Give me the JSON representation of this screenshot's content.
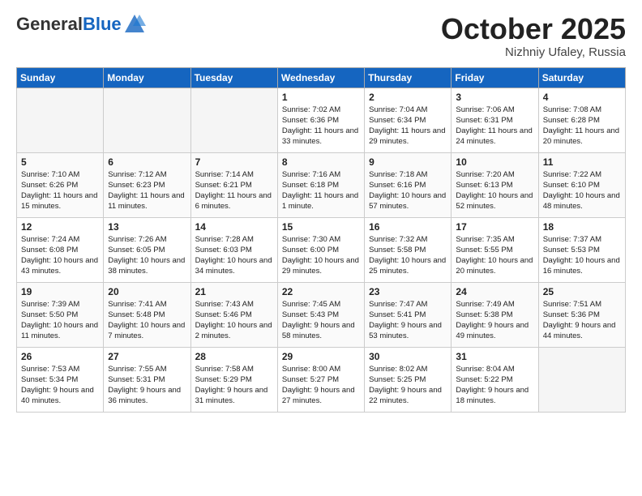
{
  "header": {
    "logo_general": "General",
    "logo_blue": "Blue",
    "month_title": "October 2025",
    "location": "Nizhniy Ufaley, Russia"
  },
  "weekdays": [
    "Sunday",
    "Monday",
    "Tuesday",
    "Wednesday",
    "Thursday",
    "Friday",
    "Saturday"
  ],
  "weeks": [
    [
      {
        "day": "",
        "empty": true
      },
      {
        "day": "",
        "empty": true
      },
      {
        "day": "",
        "empty": true
      },
      {
        "day": "1",
        "sunrise": "7:02 AM",
        "sunset": "6:36 PM",
        "daylight": "11 hours and 33 minutes."
      },
      {
        "day": "2",
        "sunrise": "7:04 AM",
        "sunset": "6:34 PM",
        "daylight": "11 hours and 29 minutes."
      },
      {
        "day": "3",
        "sunrise": "7:06 AM",
        "sunset": "6:31 PM",
        "daylight": "11 hours and 24 minutes."
      },
      {
        "day": "4",
        "sunrise": "7:08 AM",
        "sunset": "6:28 PM",
        "daylight": "11 hours and 20 minutes."
      }
    ],
    [
      {
        "day": "5",
        "sunrise": "7:10 AM",
        "sunset": "6:26 PM",
        "daylight": "11 hours and 15 minutes."
      },
      {
        "day": "6",
        "sunrise": "7:12 AM",
        "sunset": "6:23 PM",
        "daylight": "11 hours and 11 minutes."
      },
      {
        "day": "7",
        "sunrise": "7:14 AM",
        "sunset": "6:21 PM",
        "daylight": "11 hours and 6 minutes."
      },
      {
        "day": "8",
        "sunrise": "7:16 AM",
        "sunset": "6:18 PM",
        "daylight": "11 hours and 1 minute."
      },
      {
        "day": "9",
        "sunrise": "7:18 AM",
        "sunset": "6:16 PM",
        "daylight": "10 hours and 57 minutes."
      },
      {
        "day": "10",
        "sunrise": "7:20 AM",
        "sunset": "6:13 PM",
        "daylight": "10 hours and 52 minutes."
      },
      {
        "day": "11",
        "sunrise": "7:22 AM",
        "sunset": "6:10 PM",
        "daylight": "10 hours and 48 minutes."
      }
    ],
    [
      {
        "day": "12",
        "sunrise": "7:24 AM",
        "sunset": "6:08 PM",
        "daylight": "10 hours and 43 minutes."
      },
      {
        "day": "13",
        "sunrise": "7:26 AM",
        "sunset": "6:05 PM",
        "daylight": "10 hours and 38 minutes."
      },
      {
        "day": "14",
        "sunrise": "7:28 AM",
        "sunset": "6:03 PM",
        "daylight": "10 hours and 34 minutes."
      },
      {
        "day": "15",
        "sunrise": "7:30 AM",
        "sunset": "6:00 PM",
        "daylight": "10 hours and 29 minutes."
      },
      {
        "day": "16",
        "sunrise": "7:32 AM",
        "sunset": "5:58 PM",
        "daylight": "10 hours and 25 minutes."
      },
      {
        "day": "17",
        "sunrise": "7:35 AM",
        "sunset": "5:55 PM",
        "daylight": "10 hours and 20 minutes."
      },
      {
        "day": "18",
        "sunrise": "7:37 AM",
        "sunset": "5:53 PM",
        "daylight": "10 hours and 16 minutes."
      }
    ],
    [
      {
        "day": "19",
        "sunrise": "7:39 AM",
        "sunset": "5:50 PM",
        "daylight": "10 hours and 11 minutes."
      },
      {
        "day": "20",
        "sunrise": "7:41 AM",
        "sunset": "5:48 PM",
        "daylight": "10 hours and 7 minutes."
      },
      {
        "day": "21",
        "sunrise": "7:43 AM",
        "sunset": "5:46 PM",
        "daylight": "10 hours and 2 minutes."
      },
      {
        "day": "22",
        "sunrise": "7:45 AM",
        "sunset": "5:43 PM",
        "daylight": "9 hours and 58 minutes."
      },
      {
        "day": "23",
        "sunrise": "7:47 AM",
        "sunset": "5:41 PM",
        "daylight": "9 hours and 53 minutes."
      },
      {
        "day": "24",
        "sunrise": "7:49 AM",
        "sunset": "5:38 PM",
        "daylight": "9 hours and 49 minutes."
      },
      {
        "day": "25",
        "sunrise": "7:51 AM",
        "sunset": "5:36 PM",
        "daylight": "9 hours and 44 minutes."
      }
    ],
    [
      {
        "day": "26",
        "sunrise": "7:53 AM",
        "sunset": "5:34 PM",
        "daylight": "9 hours and 40 minutes."
      },
      {
        "day": "27",
        "sunrise": "7:55 AM",
        "sunset": "5:31 PM",
        "daylight": "9 hours and 36 minutes."
      },
      {
        "day": "28",
        "sunrise": "7:58 AM",
        "sunset": "5:29 PM",
        "daylight": "9 hours and 31 minutes."
      },
      {
        "day": "29",
        "sunrise": "8:00 AM",
        "sunset": "5:27 PM",
        "daylight": "9 hours and 27 minutes."
      },
      {
        "day": "30",
        "sunrise": "8:02 AM",
        "sunset": "5:25 PM",
        "daylight": "9 hours and 22 minutes."
      },
      {
        "day": "31",
        "sunrise": "8:04 AM",
        "sunset": "5:22 PM",
        "daylight": "9 hours and 18 minutes."
      },
      {
        "day": "",
        "empty": true
      }
    ]
  ]
}
